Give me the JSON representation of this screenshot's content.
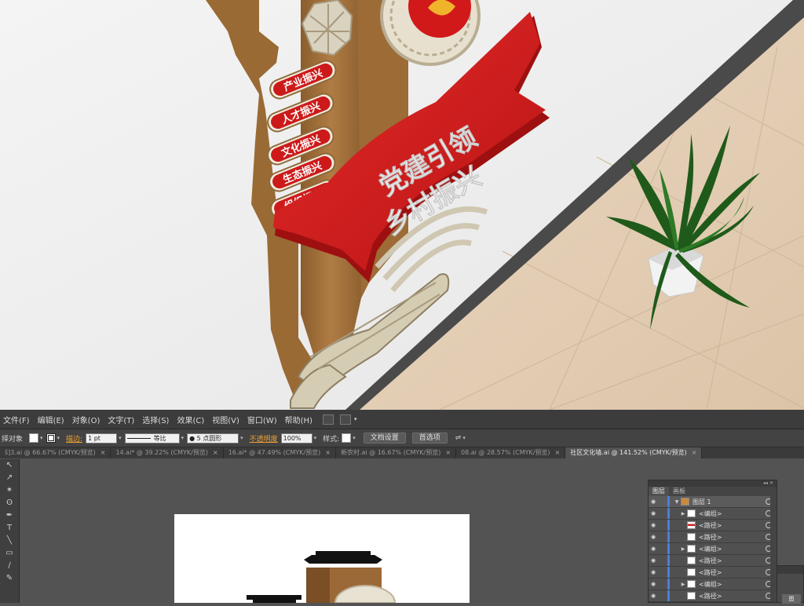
{
  "render": {
    "ribbon_line1": "党建引领",
    "ribbon_line2": "乡村振兴",
    "pills": [
      "产业振兴",
      "人才振兴",
      "文化振兴",
      "生态振兴",
      "组织振兴"
    ]
  },
  "menubar": {
    "items": [
      "文件(F)",
      "编辑(E)",
      "对象(O)",
      "文字(T)",
      "选择(S)",
      "效果(C)",
      "视图(V)",
      "窗口(W)",
      "帮助(H)"
    ]
  },
  "control": {
    "selection_label": "择对象",
    "stroke_label": "描边:",
    "stroke_value": "1 pt",
    "stroke_profile": "等比",
    "brush": "● 5 点圆形",
    "opacity_label": "不透明度",
    "opacity_value": "100%",
    "style_label": "样式:",
    "doc_setup_button": "文档设置",
    "prefs_button": "首选项"
  },
  "tabs": [
    {
      "label": "ŝ]3.ai @ 66.67% (CMYK/预览)",
      "close": "×",
      "active": false
    },
    {
      "label": "14.ai* @ 39.22% (CMYK/预览)",
      "close": "×",
      "active": false
    },
    {
      "label": "16.ai* @ 47.49% (CMYK/预览)",
      "close": "×",
      "active": false
    },
    {
      "label": "新农村.ai @ 16.67% (CMYK/预览)",
      "close": "×",
      "active": false
    },
    {
      "label": "08.ai @ 28.57% (CMYK/预览)",
      "close": "×",
      "active": false
    },
    {
      "label": "社区文化墙.ai @ 141.52% (CMYK/预览)",
      "close": "×",
      "active": true
    }
  ],
  "tools": [
    "selection-tool",
    "direct-selection-tool",
    "magic-wand-tool",
    "lasso-tool",
    "pen-tool",
    "type-tool",
    "line-tool",
    "rectangle-tool",
    "paintbrush-tool",
    "pencil-tool"
  ],
  "layers_panel": {
    "tabs": [
      "图层",
      "画板"
    ],
    "layer_name": "图层 1",
    "rows": [
      {
        "name": "<编组>",
        "group": true
      },
      {
        "name": "<路径>",
        "group": false
      },
      {
        "name": "<路径>",
        "group": false
      },
      {
        "name": "<编组>",
        "group": true
      },
      {
        "name": "<路径>",
        "group": false
      },
      {
        "name": "<路径>",
        "group": false
      },
      {
        "name": "<编组>",
        "group": true
      },
      {
        "name": "<路径>",
        "group": false
      }
    ]
  },
  "panel2": {
    "label": "图"
  },
  "colors": {
    "accent_red": "#d91c1c",
    "wood_brown": "#a8773f",
    "layer_blue": "#4a7fd8"
  }
}
